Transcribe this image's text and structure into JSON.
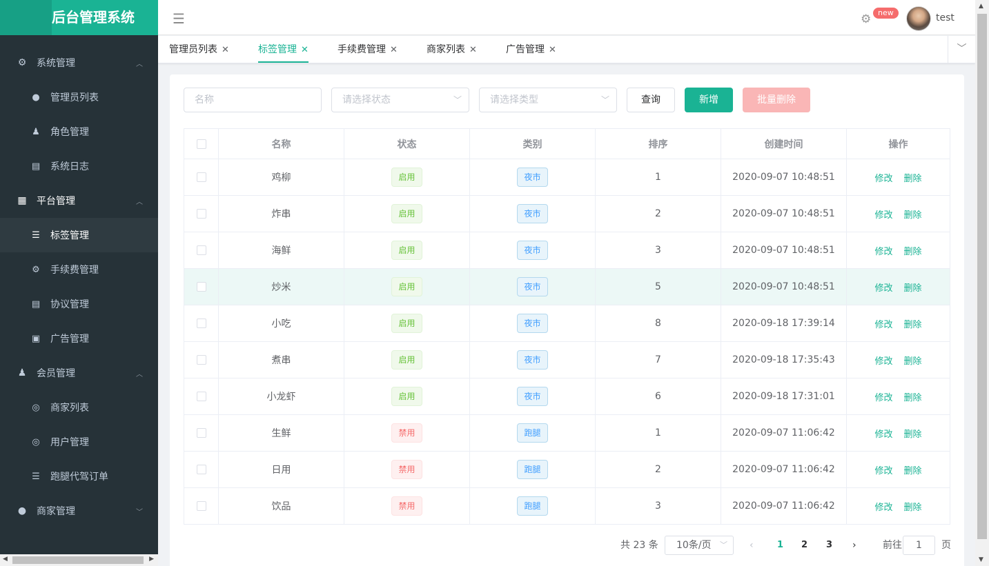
{
  "app": {
    "title": "后台管理系统",
    "username": "test",
    "badge": "new"
  },
  "sidebar": {
    "groups": [
      {
        "label": "系统管理",
        "icon": "gear-icon",
        "items": [
          {
            "label": "管理员列表",
            "icon": "user-icon"
          },
          {
            "label": "角色管理",
            "icon": "role-icon"
          },
          {
            "label": "系统日志",
            "icon": "document-icon"
          }
        ]
      },
      {
        "label": "平台管理",
        "icon": "grid-icon",
        "items": [
          {
            "label": "标签管理",
            "icon": "list-icon"
          },
          {
            "label": "手续费管理",
            "icon": "gear-icon"
          },
          {
            "label": "协议管理",
            "icon": "document-icon"
          },
          {
            "label": "广告管理",
            "icon": "ad-icon"
          }
        ]
      },
      {
        "label": "会员管理",
        "icon": "role-icon",
        "items": [
          {
            "label": "商家列表",
            "icon": "person-circle-icon"
          },
          {
            "label": "用户管理",
            "icon": "person-circle-icon"
          },
          {
            "label": "跑腿代驾订单",
            "icon": "list-icon"
          }
        ]
      },
      {
        "label": "商家管理",
        "icon": "user-icon",
        "items": []
      }
    ],
    "active_item": "标签管理"
  },
  "tabs": [
    {
      "label": "管理员列表",
      "active": false
    },
    {
      "label": "标签管理",
      "active": true
    },
    {
      "label": "手续费管理",
      "active": false
    },
    {
      "label": "商家列表",
      "active": false
    },
    {
      "label": "广告管理",
      "active": false
    }
  ],
  "filters": {
    "name_placeholder": "名称",
    "status_placeholder": "请选择状态",
    "type_placeholder": "请选择类型",
    "query_label": "查询",
    "add_label": "新增",
    "batch_delete_label": "批量删除"
  },
  "table": {
    "headers": [
      "名称",
      "状态",
      "类别",
      "排序",
      "创建时间",
      "操作"
    ],
    "edit_label": "修改",
    "delete_label": "删除",
    "rows": [
      {
        "name": "鸡柳",
        "status": "启用",
        "type": "夜市",
        "sort": "1",
        "time": "2020-09-07 10:48:51"
      },
      {
        "name": "炸串",
        "status": "启用",
        "type": "夜市",
        "sort": "2",
        "time": "2020-09-07 10:48:51"
      },
      {
        "name": "海鲜",
        "status": "启用",
        "type": "夜市",
        "sort": "3",
        "time": "2020-09-07 10:48:51"
      },
      {
        "name": "炒米",
        "status": "启用",
        "type": "夜市",
        "sort": "5",
        "time": "2020-09-07 10:48:51"
      },
      {
        "name": "小吃",
        "status": "启用",
        "type": "夜市",
        "sort": "8",
        "time": "2020-09-18 17:39:14"
      },
      {
        "name": "煮串",
        "status": "启用",
        "type": "夜市",
        "sort": "7",
        "time": "2020-09-18 17:35:43"
      },
      {
        "name": "小龙虾",
        "status": "启用",
        "type": "夜市",
        "sort": "6",
        "time": "2020-09-18 17:31:01"
      },
      {
        "name": "生鲜",
        "status": "禁用",
        "type": "跑腿",
        "sort": "1",
        "time": "2020-09-07 11:06:42"
      },
      {
        "name": "日用",
        "status": "禁用",
        "type": "跑腿",
        "sort": "2",
        "time": "2020-09-07 11:06:42"
      },
      {
        "name": "饮品",
        "status": "禁用",
        "type": "跑腿",
        "sort": "3",
        "time": "2020-09-07 11:06:42"
      }
    ]
  },
  "pagination": {
    "total": "共 23 条",
    "page_size": "10条/页",
    "pages": [
      "1",
      "2",
      "3"
    ],
    "current": "1",
    "goto_label": "前往",
    "goto_value": "1",
    "page_suffix": "页"
  },
  "colors": {
    "accent": "#1ab394",
    "sidebar_bg": "#263238",
    "enabled": "#67c23a",
    "disabled": "#f56c6c",
    "type_tag": "#409eff"
  }
}
